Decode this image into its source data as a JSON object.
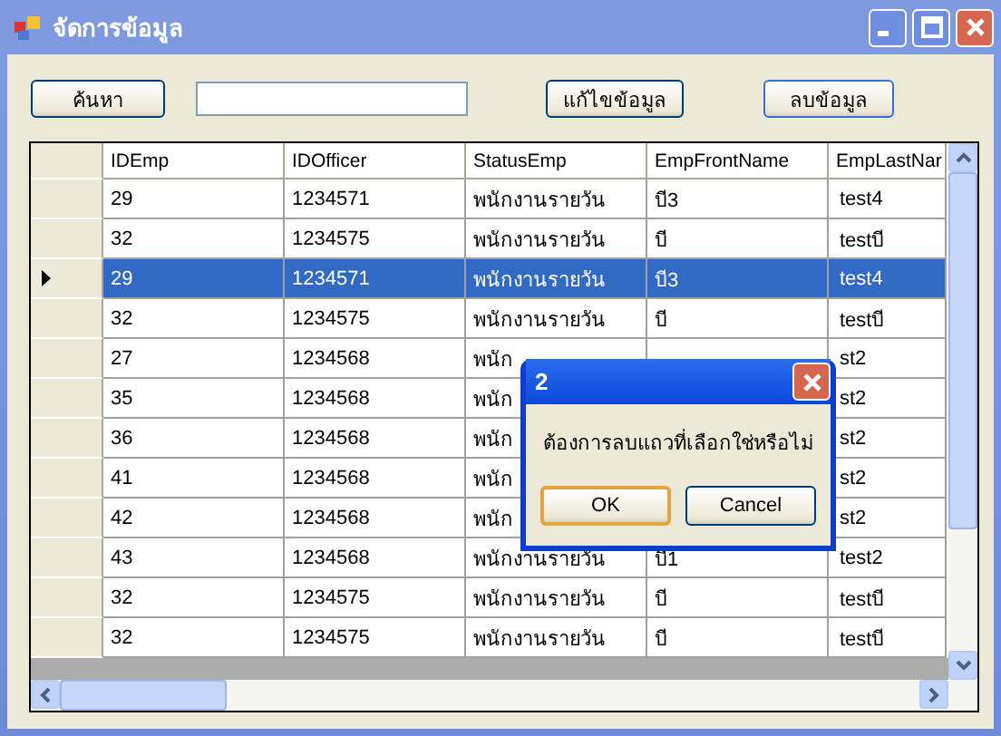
{
  "window": {
    "title": "จัดการข้อมูล"
  },
  "toolbar": {
    "search_button": "ค้นหา",
    "edit_button": "แก้ไขข้อมูล",
    "delete_button": "ลบข้อมูล"
  },
  "table": {
    "columns": [
      "IDEmp",
      "IDOfficer",
      "StatusEmp",
      "EmpFrontName",
      "EmpLastNar"
    ],
    "rows": [
      {
        "selected": false,
        "cells": [
          "29",
          "1234571",
          "พนักงานรายวัน",
          "บี3",
          "test4"
        ]
      },
      {
        "selected": false,
        "cells": [
          "32",
          "1234575",
          "พนักงานรายวัน",
          "บี",
          "testบี"
        ]
      },
      {
        "selected": true,
        "cells": [
          "29",
          "1234571",
          "พนักงานรายวัน",
          "บี3",
          "test4"
        ]
      },
      {
        "selected": false,
        "cells": [
          "32",
          "1234575",
          "พนักงานรายวัน",
          "บี",
          "testบี"
        ]
      },
      {
        "selected": false,
        "cells": [
          "27",
          "1234568",
          "พนัก",
          null,
          "st2"
        ]
      },
      {
        "selected": false,
        "cells": [
          "35",
          "1234568",
          "พนัก",
          null,
          "st2"
        ]
      },
      {
        "selected": false,
        "cells": [
          "36",
          "1234568",
          "พนัก",
          null,
          "st2"
        ]
      },
      {
        "selected": false,
        "cells": [
          "41",
          "1234568",
          "พนัก",
          null,
          "st2"
        ]
      },
      {
        "selected": false,
        "cells": [
          "42",
          "1234568",
          "พนัก",
          null,
          "st2"
        ]
      },
      {
        "selected": false,
        "cells": [
          "43",
          "1234568",
          "พนักงานรายวัน",
          "บี1",
          "test2"
        ]
      },
      {
        "selected": false,
        "cells": [
          "32",
          "1234575",
          "พนักงานรายวัน",
          "บี",
          "testบี"
        ]
      },
      {
        "selected": false,
        "cells": [
          "32",
          "1234575",
          "พนักงานรายวัน",
          "บี",
          "testบี"
        ]
      }
    ]
  },
  "dialog": {
    "title": "2",
    "message": "ต้องการลบแถวที่เลือกใช่หรือไม่",
    "buttons": [
      {
        "label": "OK",
        "selected": true
      },
      {
        "label": "Cancel",
        "selected": false
      }
    ]
  }
}
